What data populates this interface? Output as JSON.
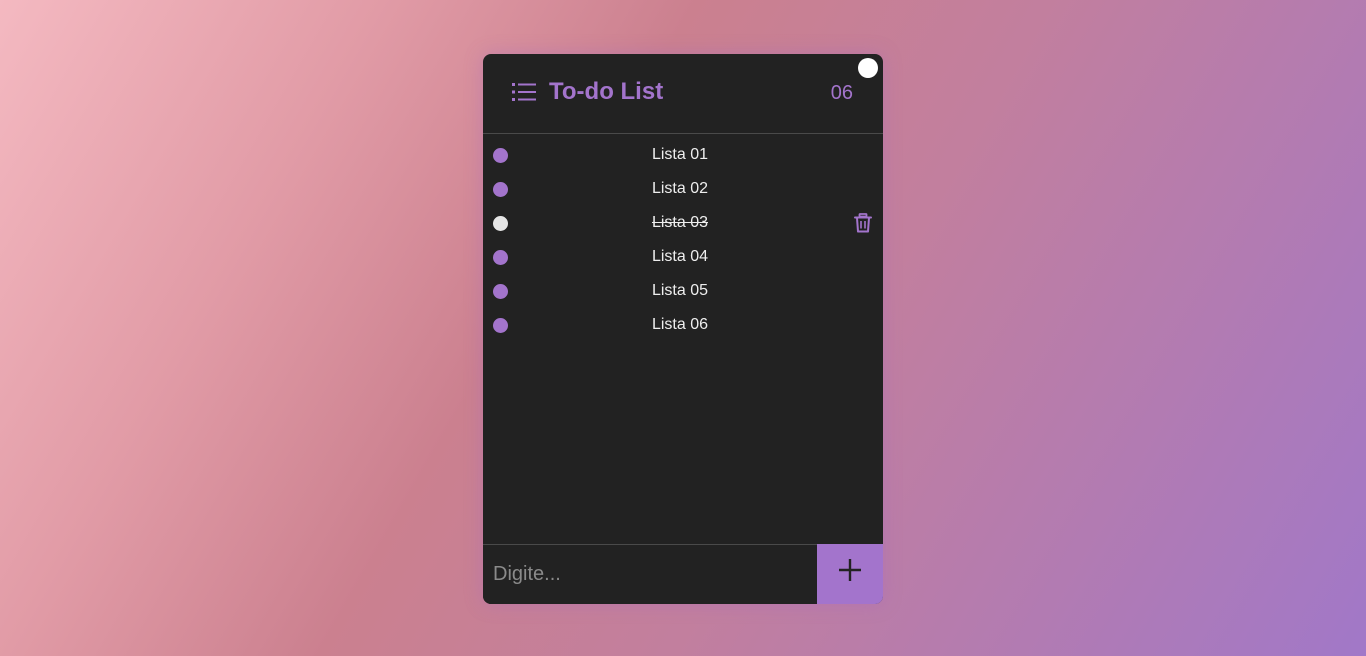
{
  "header": {
    "title": "To-do List",
    "count": "06"
  },
  "tasks": [
    {
      "label": "Lista 01",
      "done": false
    },
    {
      "label": "Lista 02",
      "done": false
    },
    {
      "label": "Lista 03",
      "done": true
    },
    {
      "label": "Lista 04",
      "done": false
    },
    {
      "label": "Lista 05",
      "done": false
    },
    {
      "label": "Lista 06",
      "done": false
    }
  ],
  "input": {
    "placeholder": "Digite...",
    "value": ""
  },
  "icons": {
    "header": "list-icon",
    "delete": "trash-icon",
    "add": "plus-icon",
    "theme_toggle": "circle-toggle"
  },
  "colors": {
    "accent": "#a374cc",
    "card_bg": "#222222",
    "done_dot": "#e6e6e6",
    "text": "#eeeeee"
  }
}
